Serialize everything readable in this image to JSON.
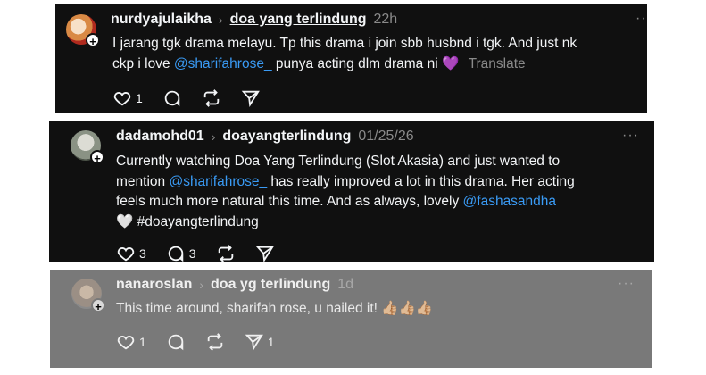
{
  "posts": [
    {
      "username": "nurdyajulaikha",
      "topic": "doa yang terlindung",
      "time": "22h",
      "text_1": "I jarang tgk drama melayu. Tp this drama i join sbb husbnd i tgk. And just nk",
      "text_2_pre": "ckp i love ",
      "mention_1": "@sharifahrose_",
      "text_2_post": " punya acting dlm drama ni ",
      "emoji": "💜",
      "translate": "Translate",
      "likes": "1",
      "replies": "",
      "reposts": "",
      "shares": ""
    },
    {
      "username": "dadamohd01",
      "topic": "doayangterlindung",
      "time": "01/25/26",
      "text_1": "Currently watching Doa Yang Terlindung (Slot Akasia) and just wanted to",
      "text_2_pre": "mention ",
      "mention_1": "@sharifahrose_",
      "text_2_post": " has really improved a lot in this drama. Her acting",
      "text_3_pre": "feels much more natural this time. And as always, lovely ",
      "mention_2": "@fashasandha",
      "text_4": "🤍 #doayangterlindung",
      "likes": "3",
      "replies": "3",
      "reposts": "",
      "shares": ""
    },
    {
      "username": "nanaroslan",
      "topic": "doa yg terlindung",
      "time": "1d",
      "text_1": "This time around, sharifah rose, u nailed it! 👍🏼👍🏼👍🏼",
      "likes": "1",
      "replies": "",
      "reposts": "",
      "shares": "1"
    }
  ],
  "icons": {
    "more": "more-options-icon",
    "like": "heart-icon",
    "reply": "comment-icon",
    "repost": "repost-icon",
    "share": "send-icon",
    "follow": "plus-icon"
  },
  "colors": {
    "card_bg": "#101010",
    "card_bg_faded": "#797979",
    "mention": "#3a9bf5",
    "muted": "#8a8a8a"
  }
}
